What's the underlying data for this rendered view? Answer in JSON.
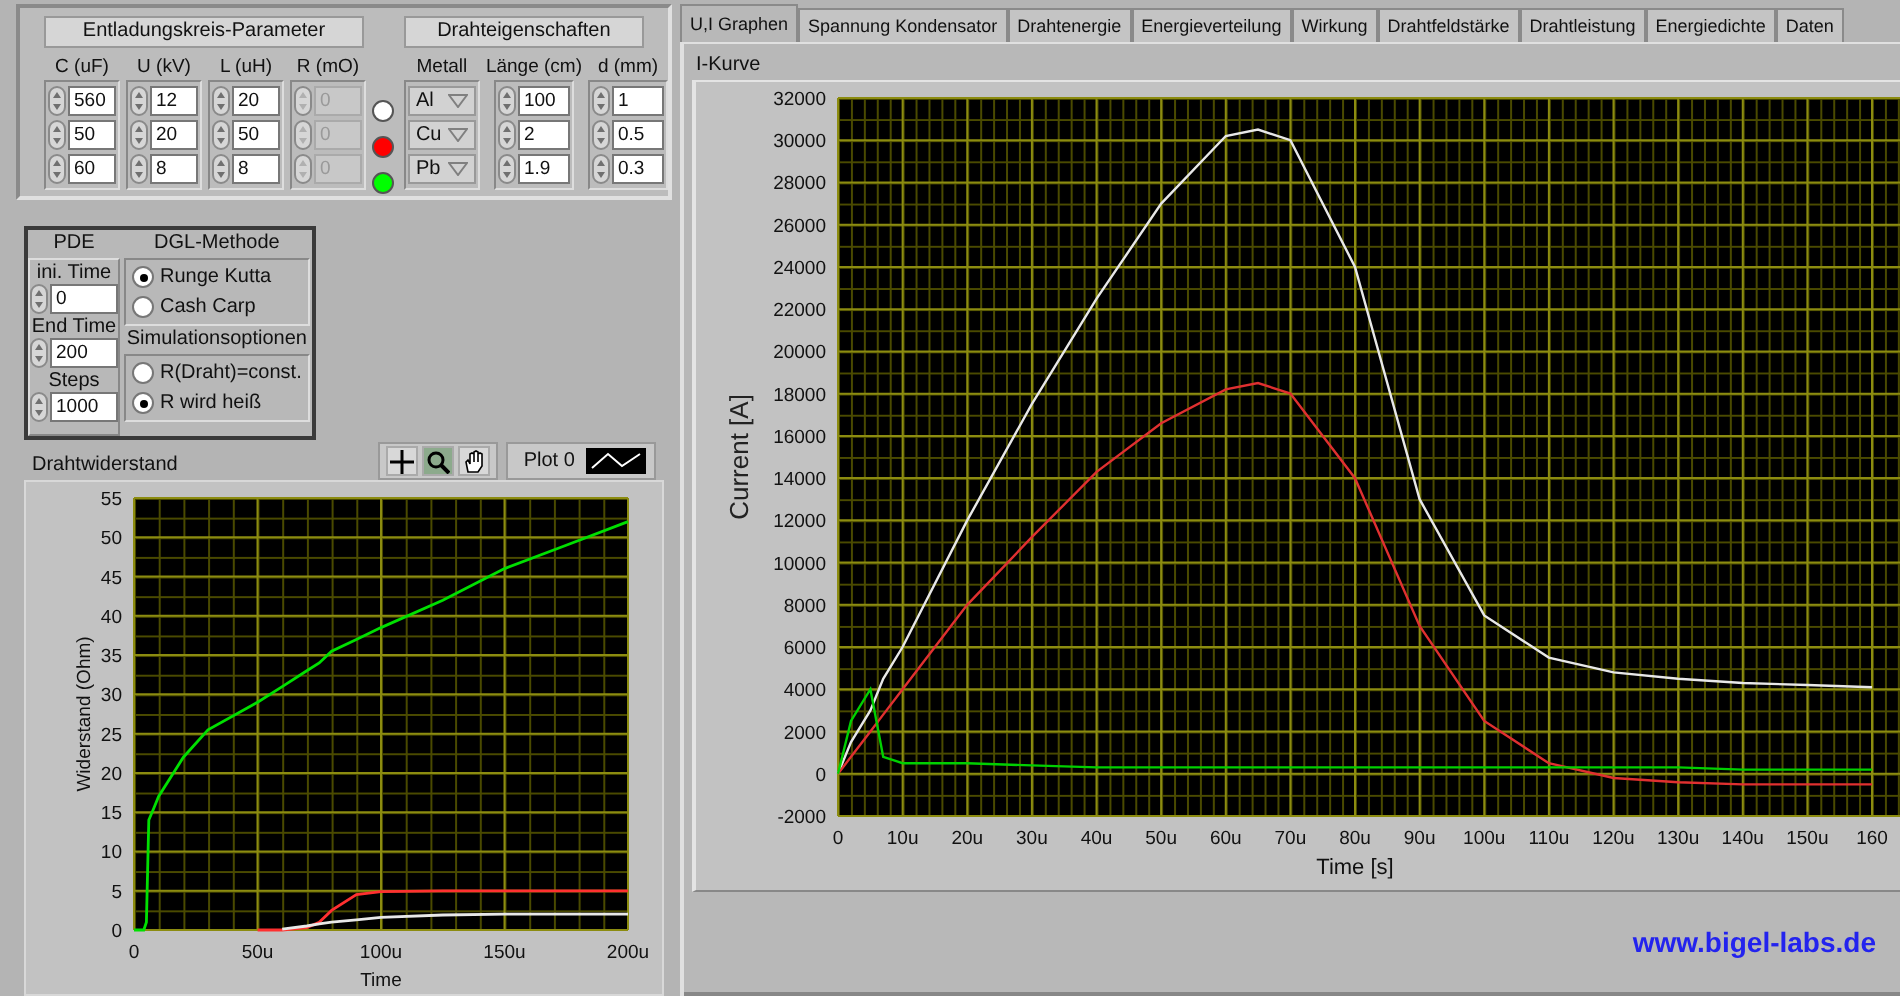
{
  "parameter_panel": {
    "circuit": {
      "title": "Entladungskreis-Parameter",
      "columns": [
        {
          "header": "C (uF)",
          "disabled": false,
          "values": [
            "560",
            "50",
            "60"
          ]
        },
        {
          "header": "U (kV)",
          "disabled": false,
          "values": [
            "12",
            "20",
            "8"
          ]
        },
        {
          "header": "L (uH)",
          "disabled": false,
          "values": [
            "20",
            "50",
            "8"
          ]
        },
        {
          "header": "R (mO)",
          "disabled": true,
          "values": [
            "0",
            "0",
            "0"
          ]
        }
      ]
    },
    "leds": [
      {
        "color": "#ffffff"
      },
      {
        "color": "#ff0000"
      },
      {
        "color": "#00ff00"
      }
    ],
    "wire": {
      "title": "Drahteigenschaften",
      "metal_header": "Metall",
      "metals": [
        "Al",
        "Cu",
        "Pb"
      ],
      "columns": [
        {
          "header": "Länge (cm)",
          "values": [
            "100",
            "2",
            "1.9"
          ]
        },
        {
          "header": "d (mm)",
          "values": [
            "1",
            "0.5",
            "0.3"
          ]
        }
      ]
    }
  },
  "pde": {
    "title": "PDE",
    "fields": [
      {
        "label": "ini. Time",
        "value": "0"
      },
      {
        "label": "End Time",
        "value": "200"
      },
      {
        "label": "Steps",
        "value": "1000"
      }
    ]
  },
  "dgl_method": {
    "title": "DGL-Methode",
    "options": [
      {
        "label": "Runge Kutta",
        "selected": true
      },
      {
        "label": "Cash Carp",
        "selected": false
      }
    ]
  },
  "simulation_options": {
    "title": "Simulationsoptionen",
    "options": [
      {
        "label": "R(Draht)=const.",
        "selected": false
      },
      {
        "label": "R wird heiß",
        "selected": true
      }
    ]
  },
  "resistance_graph": {
    "title": "Drahtwiderstand",
    "legend": "Plot 0",
    "chart_data": {
      "type": "line",
      "xlabel": "Time",
      "ylabel": "Widerstand (Ohm)",
      "x": [
        0,
        4,
        5,
        6,
        8,
        10,
        20,
        30,
        50,
        60,
        70,
        75,
        80,
        90,
        100,
        125,
        150,
        175,
        200
      ],
      "series": [
        {
          "color": "#00e000",
          "values": [
            0,
            0,
            1,
            14,
            15.5,
            17,
            22,
            25.5,
            29,
            31,
            33,
            34,
            35.5,
            37,
            38.5,
            42,
            46,
            49,
            52
          ]
        },
        {
          "color": "#ff3030",
          "values": [
            null,
            null,
            null,
            null,
            null,
            null,
            null,
            null,
            0,
            0,
            0.3,
            1,
            2.5,
            4.5,
            4.9,
            5,
            5,
            5,
            5
          ]
        },
        {
          "color": "#e8e8e8",
          "values": [
            null,
            null,
            null,
            null,
            null,
            null,
            null,
            null,
            null,
            0.1,
            0.5,
            0.8,
            1,
            1.3,
            1.6,
            1.9,
            2,
            2,
            2
          ]
        }
      ],
      "grid": true,
      "xlim": [
        0,
        200
      ],
      "ylim": [
        0,
        55
      ],
      "xticks": [
        {
          "value": 0,
          "label": "0"
        },
        {
          "value": 50,
          "label": "50u"
        },
        {
          "value": 100,
          "label": "100u"
        },
        {
          "value": 150,
          "label": "150u"
        },
        {
          "value": 200,
          "label": "200u"
        }
      ],
      "yticks": [
        0,
        5,
        10,
        15,
        20,
        25,
        30,
        35,
        40,
        45,
        50,
        55
      ]
    }
  },
  "tabs": [
    {
      "label": "U,I Graphen",
      "selected": true
    },
    {
      "label": "Spannung Kondensator",
      "selected": false
    },
    {
      "label": "Drahtenergie",
      "selected": false
    },
    {
      "label": "Energieverteilung",
      "selected": false
    },
    {
      "label": "Wirkung",
      "selected": false
    },
    {
      "label": "Drahtfeldstärke",
      "selected": false
    },
    {
      "label": "Drahtleistung",
      "selected": false
    },
    {
      "label": "Energiedichte",
      "selected": false
    },
    {
      "label": "Daten",
      "selected": false
    }
  ],
  "current_graph": {
    "title": "I-Kurve",
    "chart_data": {
      "type": "line",
      "xlabel": "Time [s]",
      "ylabel": "Current [A]",
      "x": [
        0,
        2,
        5,
        7,
        10,
        20,
        30,
        40,
        50,
        60,
        65,
        70,
        80,
        90,
        100,
        110,
        120,
        130,
        140,
        150,
        160
      ],
      "series": [
        {
          "color": "#e8e8e8",
          "values": [
            0,
            1500,
            3000,
            4500,
            6000,
            12000,
            17500,
            22500,
            27000,
            30200,
            30500,
            30000,
            24000,
            13000,
            7500,
            5500,
            4800,
            4500,
            4300,
            4200,
            4100
          ]
        },
        {
          "color": "#e03030",
          "values": [
            0,
            800,
            2000,
            2800,
            4000,
            8000,
            11200,
            14300,
            16600,
            18200,
            18500,
            18000,
            14000,
            7000,
            2500,
            500,
            -200,
            -400,
            -500,
            -500,
            -500
          ]
        },
        {
          "color": "#00d000",
          "values": [
            0,
            2500,
            4000,
            800,
            500,
            500,
            400,
            300,
            300,
            300,
            300,
            300,
            300,
            300,
            300,
            300,
            300,
            300,
            200,
            200,
            200
          ]
        }
      ],
      "grid": true,
      "xlim": [
        0,
        160
      ],
      "ylim": [
        -2000,
        32000
      ],
      "xticks": [
        {
          "value": 0,
          "label": "0"
        },
        {
          "value": 10,
          "label": "10u"
        },
        {
          "value": 20,
          "label": "20u"
        },
        {
          "value": 30,
          "label": "30u"
        },
        {
          "value": 40,
          "label": "40u"
        },
        {
          "value": 50,
          "label": "50u"
        },
        {
          "value": 60,
          "label": "60u"
        },
        {
          "value": 70,
          "label": "70u"
        },
        {
          "value": 80,
          "label": "80u"
        },
        {
          "value": 90,
          "label": "90u"
        },
        {
          "value": 100,
          "label": "100u"
        },
        {
          "value": 110,
          "label": "110u"
        },
        {
          "value": 120,
          "label": "120u"
        },
        {
          "value": 130,
          "label": "130u"
        },
        {
          "value": 140,
          "label": "140u"
        },
        {
          "value": 150,
          "label": "150u"
        },
        {
          "value": 160,
          "label": "160"
        }
      ],
      "yticks": [
        -2000,
        0,
        2000,
        4000,
        6000,
        8000,
        10000,
        12000,
        14000,
        16000,
        18000,
        20000,
        22000,
        24000,
        26000,
        28000,
        30000,
        32000
      ]
    }
  },
  "footer_link": "www.bigel-labs.de"
}
